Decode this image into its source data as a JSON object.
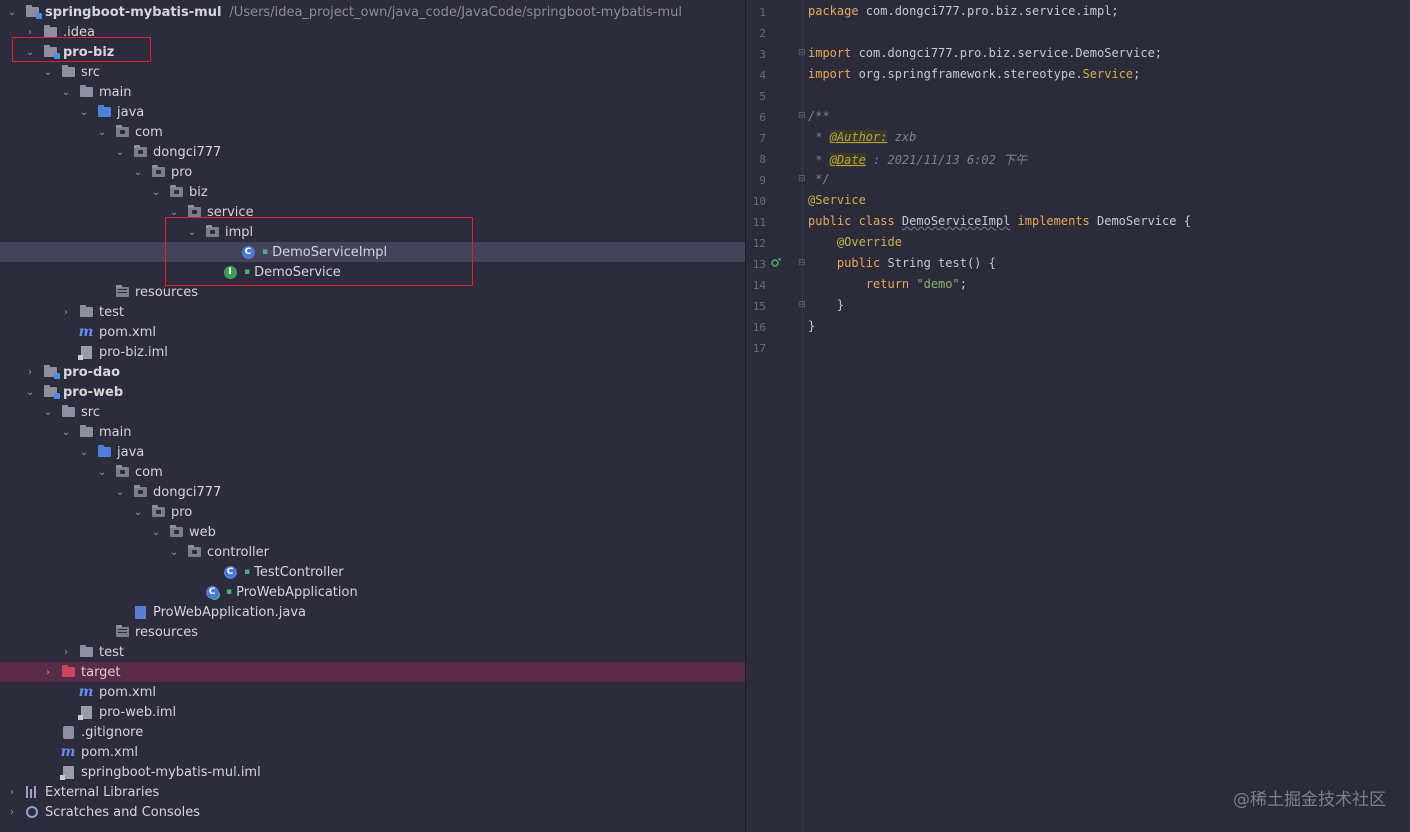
{
  "project": {
    "root_name": "springboot-mybatis-mul",
    "root_path": "/Users/idea_project_own/java_code/JavaCode/springboot-mybatis-mul"
  },
  "tree": [
    {
      "label": "springboot-mybatis-mul",
      "bold": true,
      "icon": "module-folder",
      "chevron": "down",
      "depth": 0,
      "path": true
    },
    {
      "label": ".idea",
      "icon": "folder",
      "chevron": "right",
      "depth": 1
    },
    {
      "label": "pro-biz",
      "bold": true,
      "icon": "module-folder",
      "chevron": "down",
      "depth": 1
    },
    {
      "label": "src",
      "icon": "folder",
      "chevron": "down",
      "depth": 2
    },
    {
      "label": "main",
      "icon": "folder",
      "chevron": "down",
      "depth": 3
    },
    {
      "label": "java",
      "icon": "source-folder",
      "chevron": "down",
      "depth": 4
    },
    {
      "label": "com",
      "icon": "package-folder",
      "chevron": "down",
      "depth": 5
    },
    {
      "label": "dongci777",
      "icon": "package-folder",
      "chevron": "down",
      "depth": 6
    },
    {
      "label": "pro",
      "icon": "package-folder",
      "chevron": "down",
      "depth": 7
    },
    {
      "label": "biz",
      "icon": "package-folder",
      "chevron": "down",
      "depth": 8
    },
    {
      "label": "service",
      "icon": "package-folder",
      "chevron": "down",
      "depth": 9
    },
    {
      "label": "impl",
      "icon": "package-folder",
      "chevron": "down",
      "depth": 10
    },
    {
      "label": "DemoServiceImpl",
      "icon": "class",
      "chevron": "none",
      "depth": 12,
      "selected": true
    },
    {
      "label": "DemoService",
      "icon": "interface",
      "chevron": "none",
      "depth": 11
    },
    {
      "label": "resources",
      "icon": "resources-folder",
      "chevron": "none",
      "depth": 5
    },
    {
      "label": "test",
      "icon": "folder",
      "chevron": "right",
      "depth": 3
    },
    {
      "label": "pom.xml",
      "icon": "maven",
      "chevron": "none",
      "depth": 3
    },
    {
      "label": "pro-biz.iml",
      "icon": "iml",
      "chevron": "none",
      "depth": 3
    },
    {
      "label": "pro-dao",
      "bold": true,
      "icon": "module-folder",
      "chevron": "right",
      "depth": 1
    },
    {
      "label": "pro-web",
      "bold": true,
      "icon": "module-folder",
      "chevron": "down",
      "depth": 1
    },
    {
      "label": "src",
      "icon": "folder",
      "chevron": "down",
      "depth": 2
    },
    {
      "label": "main",
      "icon": "folder",
      "chevron": "down",
      "depth": 3
    },
    {
      "label": "java",
      "icon": "source-folder",
      "chevron": "down",
      "depth": 4
    },
    {
      "label": "com",
      "icon": "package-folder",
      "chevron": "down",
      "depth": 5
    },
    {
      "label": "dongci777",
      "icon": "package-folder",
      "chevron": "down",
      "depth": 6
    },
    {
      "label": "pro",
      "icon": "package-folder",
      "chevron": "down",
      "depth": 7
    },
    {
      "label": "web",
      "icon": "package-folder",
      "chevron": "down",
      "depth": 8
    },
    {
      "label": "controller",
      "icon": "package-folder",
      "chevron": "down",
      "depth": 9
    },
    {
      "label": "TestController",
      "icon": "class",
      "chevron": "none",
      "depth": 11
    },
    {
      "label": "ProWebApplication",
      "icon": "app-class",
      "chevron": "none",
      "depth": 10
    },
    {
      "label": "ProWebApplication.java",
      "icon": "java-file",
      "chevron": "none",
      "depth": 6
    },
    {
      "label": "resources",
      "icon": "resources-folder",
      "chevron": "none",
      "depth": 5
    },
    {
      "label": "test",
      "icon": "folder",
      "chevron": "right",
      "depth": 3
    },
    {
      "label": "target",
      "icon": "target-folder",
      "chevron": "right",
      "depth": 2,
      "excluded": true
    },
    {
      "label": "pom.xml",
      "icon": "maven",
      "chevron": "none",
      "depth": 3
    },
    {
      "label": "pro-web.iml",
      "icon": "iml",
      "chevron": "none",
      "depth": 3
    },
    {
      "label": ".gitignore",
      "icon": "git-file",
      "chevron": "none",
      "depth": 2
    },
    {
      "label": "pom.xml",
      "icon": "maven",
      "chevron": "none",
      "depth": 2
    },
    {
      "label": "springboot-mybatis-mul.iml",
      "icon": "iml",
      "chevron": "none",
      "depth": 2
    },
    {
      "label": "External Libraries",
      "icon": "libraries",
      "chevron": "right",
      "depth": 0
    },
    {
      "label": "Scratches and Consoles",
      "icon": "scratches",
      "chevron": "right",
      "depth": 0
    }
  ],
  "editor": {
    "line_numbers": [
      "1",
      "2",
      "3",
      "4",
      "5",
      "6",
      "7",
      "8",
      "9",
      "10",
      "11",
      "12",
      "13",
      "14",
      "15",
      "16",
      "17"
    ],
    "lines": [
      {
        "n": 1,
        "parts": [
          [
            "kwx",
            "package "
          ],
          [
            "type",
            "com.dongci777.pro.biz.service.impl;"
          ]
        ]
      },
      {
        "n": 2,
        "parts": []
      },
      {
        "n": 3,
        "parts": [
          [
            "kwx",
            "import "
          ],
          [
            "type",
            "com.dongci777.pro.biz.service.DemoService;"
          ]
        ]
      },
      {
        "n": 4,
        "parts": [
          [
            "kwx",
            "import "
          ],
          [
            "type",
            "org.springframework.stereotype."
          ],
          [
            "svc",
            "Service"
          ],
          [
            "type",
            ";"
          ]
        ]
      },
      {
        "n": 5,
        "parts": []
      },
      {
        "n": 6,
        "parts": [
          [
            "cmt",
            "/**"
          ]
        ]
      },
      {
        "n": 7,
        "parts": [
          [
            "cmt",
            " * "
          ],
          [
            "tag",
            "@Author:"
          ],
          [
            "cmt",
            " zxb"
          ]
        ]
      },
      {
        "n": 8,
        "parts": [
          [
            "cmt",
            " * "
          ],
          [
            "tag",
            "@Date"
          ],
          [
            "cmt",
            " : 2021/11/13 6:02 下午"
          ]
        ]
      },
      {
        "n": 9,
        "parts": [
          [
            "cmt",
            " */"
          ]
        ]
      },
      {
        "n": 10,
        "parts": [
          [
            "ann",
            "@Service"
          ]
        ]
      },
      {
        "n": 11,
        "parts": [
          [
            "kw",
            "public class "
          ],
          [
            "squig",
            "DemoServiceImpl"
          ],
          [
            "kw",
            " implements "
          ],
          [
            "type",
            "DemoService {"
          ]
        ]
      },
      {
        "n": 12,
        "parts": [
          [
            "ann",
            "    @Override"
          ]
        ]
      },
      {
        "n": 13,
        "parts": [
          [
            "kw",
            "    public "
          ],
          [
            "type",
            "String test() {"
          ]
        ]
      },
      {
        "n": 14,
        "parts": [
          [
            "kw",
            "        return "
          ],
          [
            "str",
            "\"demo\""
          ],
          [
            "type",
            ";"
          ]
        ]
      },
      {
        "n": 15,
        "parts": [
          [
            "type",
            "    }"
          ]
        ]
      },
      {
        "n": 16,
        "parts": [
          [
            "type",
            "}"
          ]
        ]
      },
      {
        "n": 17,
        "parts": []
      }
    ]
  },
  "watermark": "@稀土掘金技术社区",
  "colors": {
    "highlight_box": "#e0202a",
    "accent_bar": "#a05fd0"
  }
}
